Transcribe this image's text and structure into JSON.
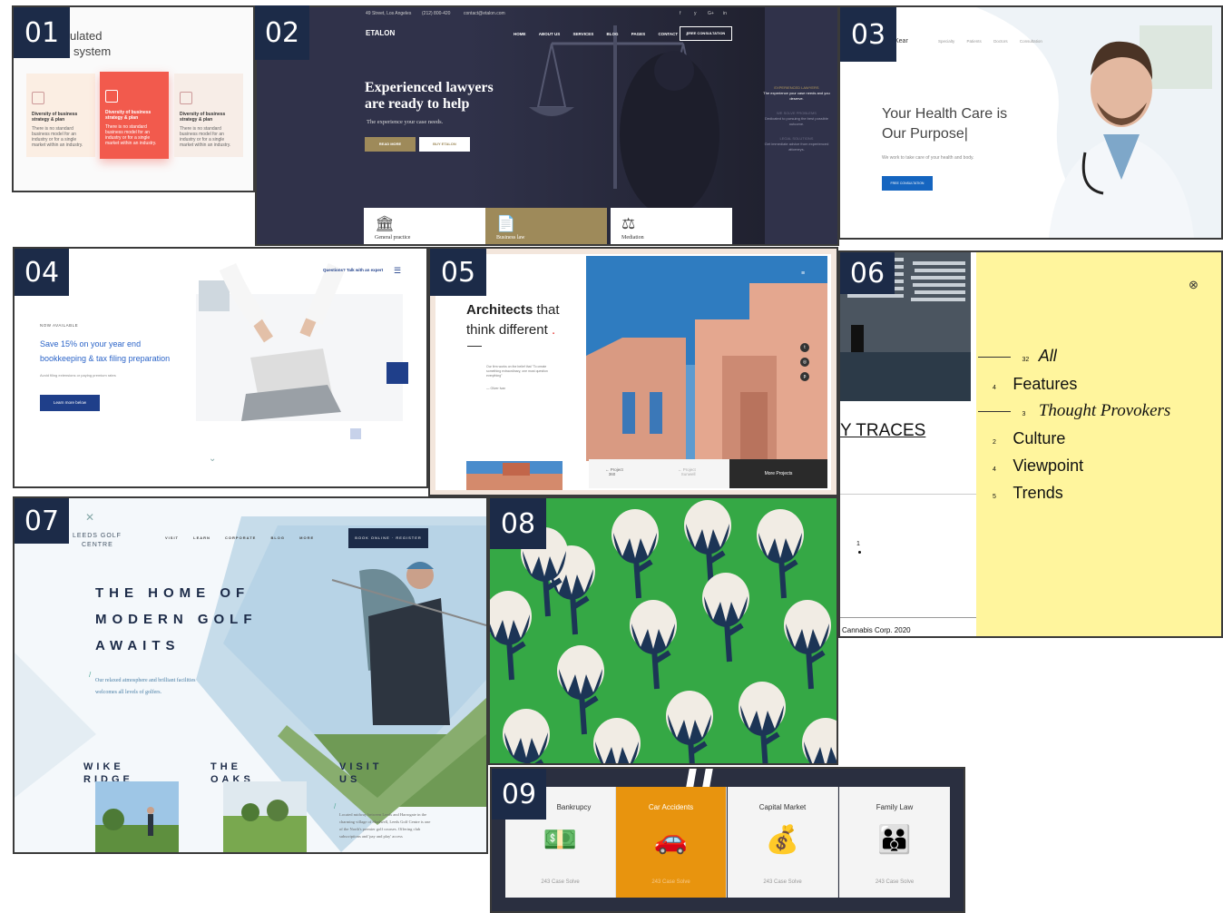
{
  "badges": [
    "01",
    "02",
    "03",
    "04",
    "05",
    "06",
    "07",
    "08",
    "09"
  ],
  "colors": {
    "badge": "#1c2b48",
    "p02_bg": "#30324a",
    "gold": "#9e8a5a",
    "p06_yellow": "#fff59d",
    "p08_green": "#35a845",
    "p09_orange": "#e8940e",
    "blue": "#1565c0"
  },
  "p01": {
    "title_line1": "ulated",
    "title_line2": "system",
    "cards": [
      {
        "title": "Diversity of business strategy & plan",
        "body": "There is no standard business model for an industry or for a single market within an industry."
      },
      {
        "title": "Diversity of business strategy & plan",
        "body": "There is no standard business model for an industry or for a single market within an industry."
      },
      {
        "title": "Diversity of business strategy & plan",
        "body": "There is no standard business model for an industry or for a single market within an industry."
      }
    ]
  },
  "p02": {
    "topbar": {
      "address": "49 Street, Los Angeles",
      "phone": "(212) 800-420",
      "email": "contact@etalon.com"
    },
    "social": [
      "f",
      "y",
      "G+",
      "in"
    ],
    "logo": "ETALON",
    "nav": [
      "HOME",
      "ABOUT US",
      "SERVICES",
      "BLOG",
      "PAGES",
      "CONTACT"
    ],
    "cta": "FREE CONSULTATION",
    "headline1": "Experienced lawyers",
    "headline2": "are ready to help",
    "sub": "The experience your case needs.",
    "btn_primary": "READ MORE",
    "btn_secondary": "BUY ETALON",
    "side": [
      {
        "title": "EXPERIENCED LAWYERS",
        "text": "The experience your case needs and you deserve."
      },
      {
        "title": "WE SOLVE PROBLEMS",
        "text": "Dedicated to pursuing the best possible outcome."
      },
      {
        "title": "LEGAL SOLUTIONS",
        "text": "Get immediate advice from experienced attorneys."
      }
    ],
    "tabs": [
      "General practice",
      "Business law",
      "Mediation"
    ]
  },
  "p03": {
    "logo": "Kear",
    "nav": [
      "Specialty",
      "Patients",
      "Doctors",
      "Consultation"
    ],
    "headline1": "Your Health Care is",
    "headline2": "Our Purpose|",
    "sub": "We work to take care of your health and body.",
    "btn": "FREE CONSULTATION"
  },
  "p04": {
    "top_link": "Questions? Talk with an expert",
    "eyebrow": "NOW AVAILABLE",
    "headline1": "Save 15% on your year end",
    "headline2": "bookkeeping & tax filing preparation",
    "sub": "Avoid filing extensions or paying premium rates",
    "btn": "Learn more below"
  },
  "p05": {
    "headline_bold": "Architects",
    "headline_rest": " that",
    "headline2": "think different",
    "quote": "Our firm works on the belief that \"To create something extraordinary, one must question everything\"",
    "author": "— Oliver Ivan",
    "prev_label": "Project",
    "prev_value": "360",
    "next_label": "Project",
    "next_value": "Sunwell",
    "more": "More Projects"
  },
  "p06": {
    "traces": "Y TRACES",
    "page_num": "1",
    "footer": "Cannabis Corp. 2020",
    "menu": [
      {
        "count": "32",
        "label": "All",
        "italic": true,
        "serif": false
      },
      {
        "count": "4",
        "label": "Features",
        "italic": false,
        "serif": false
      },
      {
        "count": "3",
        "label": "Thought Provokers",
        "italic": true,
        "serif": true
      },
      {
        "count": "2",
        "label": "Culture",
        "italic": false,
        "serif": false
      },
      {
        "count": "4",
        "label": "Viewpoint",
        "italic": false,
        "serif": false
      },
      {
        "count": "5",
        "label": "Trends",
        "italic": false,
        "serif": false
      }
    ]
  },
  "p07": {
    "logo1": "LEEDS GOLF",
    "logo2": "CENTRE",
    "nav": [
      "VISIT",
      "LEARN",
      "CORPORATE",
      "BLOG",
      "MORE"
    ],
    "cta": "BOOK ONLINE · REGISTER",
    "headline": [
      "THE HOME OF",
      "MODERN GOLF",
      "AWAITS"
    ],
    "sub1": "Our relaxed atmosphere and brilliant facilities",
    "sub2": "welcomes all levels of golfers.",
    "cols": [
      {
        "l1": "WIKE",
        "l2": "RIDGE"
      },
      {
        "l1": "THE",
        "l2": "OAKS"
      },
      {
        "l1": "VISIT",
        "l2": "US"
      }
    ],
    "visit_text": "Located midway between Leeds and Harrogate in the charming village of Shadwell, Leeds Golf Centre is one of the North's premier golf courses. Offering club subscriptions and 'pay and play' access"
  },
  "p09": {
    "services": [
      {
        "title": "Bankrupcy",
        "sub": "243 Case Solve",
        "icon": "money-fire-icon",
        "glyph": "💵"
      },
      {
        "title": "Car Accidents",
        "sub": "243 Case Solve",
        "icon": "car-crash-icon",
        "glyph": "🚗"
      },
      {
        "title": "Capital Market",
        "sub": "243 Case Solve",
        "icon": "money-bag-icon",
        "glyph": "💰"
      },
      {
        "title": "Family Law",
        "sub": "243 Case Solve",
        "icon": "family-house-icon",
        "glyph": "👪"
      }
    ]
  }
}
